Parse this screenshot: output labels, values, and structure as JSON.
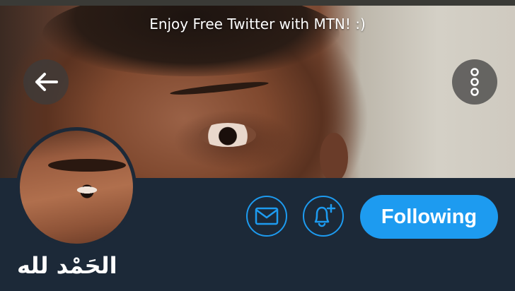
{
  "banner": {
    "promo_text": "Enjoy Free Twitter with MTN! :)"
  },
  "nav": {
    "back_icon": "arrow-left-icon",
    "more_icon": "vertical-dots-icon"
  },
  "profile": {
    "display_name": "الحَمْد لله",
    "avatar_icon": "avatar-photo",
    "actions": {
      "message_icon": "envelope-icon",
      "notify_icon": "bell-plus-icon",
      "follow_label": "Following"
    }
  },
  "colors": {
    "accent": "#1d9bf0",
    "profile_background": "#1c2938",
    "text": "#ffffff"
  }
}
